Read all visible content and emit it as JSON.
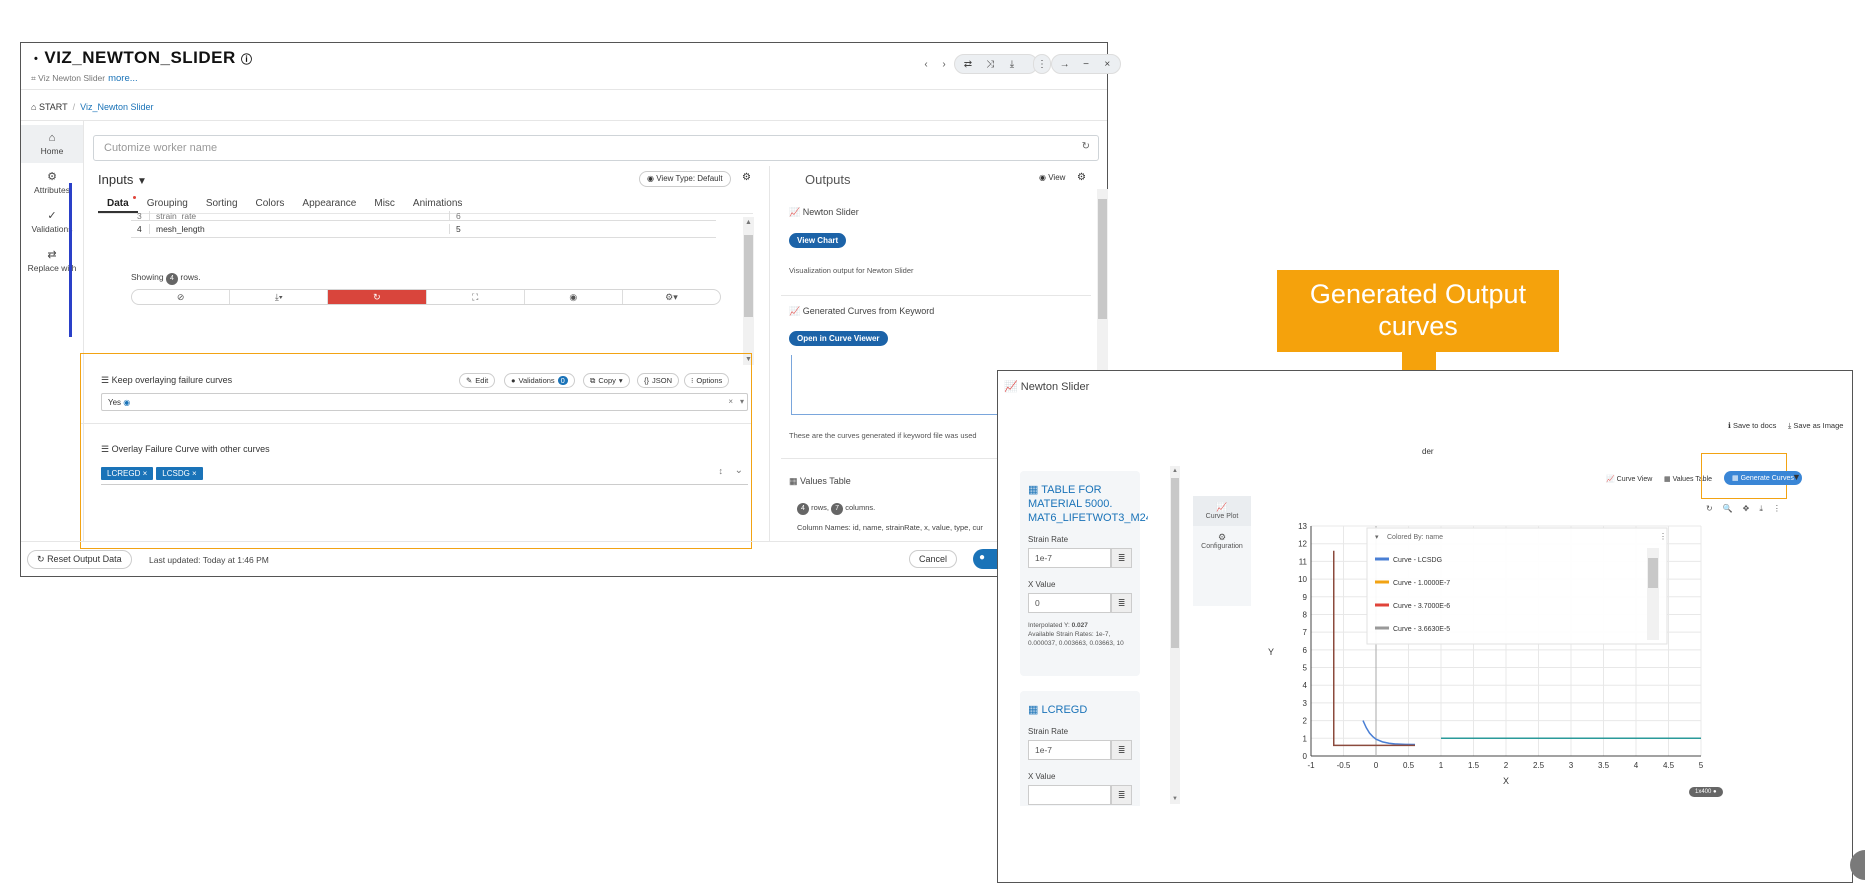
{
  "main_window": {
    "title": "VIZ_NEWTON_SLIDER",
    "subtitle": "Viz Newton Slider",
    "more_link": "more...",
    "breadcrumb": {
      "root": "START",
      "current": "Viz_Newton Slider"
    },
    "sidebar": [
      {
        "label": "Home",
        "icon": "home-icon"
      },
      {
        "label": "Attributes",
        "icon": "gear-icon"
      },
      {
        "label": "Validations",
        "icon": "check-icon"
      },
      {
        "label": "Replace with",
        "icon": "swap-icon"
      }
    ],
    "worker_name_placeholder": "Cutomize worker name",
    "inputs": {
      "header": "Inputs",
      "view_type": "View Type: Default",
      "tabs": [
        "Data",
        "Grouping",
        "Sorting",
        "Colors",
        "Appearance",
        "Misc",
        "Animations"
      ],
      "rows": [
        {
          "index": "3",
          "name": "strain_rate",
          "value": "6"
        },
        {
          "index": "4",
          "name": "mesh_length",
          "value": "5"
        }
      ],
      "showing_prefix": "Showing",
      "showing_count": "4",
      "showing_suffix": "rows."
    },
    "keep_overlaying": {
      "label": "Keep overlaying failure curves",
      "edit": "Edit",
      "validations": "Validations",
      "validations_count": "0",
      "copy": "Copy",
      "json": "JSON",
      "options": "Options",
      "value": "Yes"
    },
    "overlay": {
      "label": "Overlay Failure Curve with other curves",
      "chips": [
        "LCREGD",
        "LCSDG"
      ]
    },
    "footer": {
      "reset": "Reset Output Data",
      "updated": "Last updated: Today at 1:46 PM",
      "cancel": "Cancel"
    },
    "outputs": {
      "header": "Outputs",
      "view": "View",
      "newton": {
        "title": "Newton Slider",
        "button": "View Chart",
        "desc": "Visualization output for Newton Slider"
      },
      "curves": {
        "title": "Generated Curves from Keyword",
        "button": "Open in Curve Viewer",
        "desc": "These are the curves generated if keyword file was used"
      },
      "values": {
        "title": "Values Table",
        "rows": "4",
        "rows_label": "rows,",
        "cols": "7",
        "cols_label": "columns.",
        "columns_desc": "Column Names: id, name, strainRate, x, value, type, cur"
      }
    }
  },
  "callout": {
    "text": "Generated Output curves"
  },
  "newton_window": {
    "title": "Newton Slider",
    "save_docs": "Save to docs",
    "save_image": "Save as Image",
    "partial_title": "der",
    "curve_view": "Curve View",
    "values_table": "Values Table",
    "generate_curves": "Generate Curves",
    "side_tabs": [
      "Curve Plot",
      "Configuration"
    ],
    "table1": {
      "name": "TABLE FOR MATERIAL 5000. MAT6_LIFETWOT3_M24",
      "strain_rate_label": "Strain Rate",
      "strain_rate": "1e-7",
      "x_value_label": "X Value",
      "x_value": "0",
      "interp_label": "Interpolated Y:",
      "interp_value": "0.027",
      "available": "Available Strain Rates: 1e-7, 0.000037, 0.003663, 0.03663, 10"
    },
    "table2": {
      "name": "LCREGD",
      "strain_rate_label": "Strain Rate",
      "strain_rate": "1e-7",
      "x_value_label": "X Value"
    },
    "legend_header": "Colored By: name",
    "badge": "1x400",
    "colors": {
      "blue": "#4a7fd4",
      "orange": "#f2a313",
      "red": "#e0443a",
      "gray": "#999999",
      "brown": "#8b4a3c",
      "teal": "#2a9a9a"
    }
  },
  "chart_data": {
    "type": "line",
    "xlabel": "X",
    "ylabel": "Y",
    "xlim": [
      -1,
      5
    ],
    "ylim": [
      0,
      13
    ],
    "x_ticks": [
      "-1",
      "-0.5",
      "0",
      "0.5",
      "1",
      "1.5",
      "2",
      "2.5",
      "3",
      "3.5",
      "4",
      "4.5",
      "5"
    ],
    "y_ticks": [
      "0",
      "1",
      "2",
      "3",
      "4",
      "5",
      "6",
      "7",
      "8",
      "9",
      "10",
      "11",
      "12",
      "13"
    ],
    "legend": [
      "Curve - LCSDG",
      "Curve - 1.0000E-7",
      "Curve - 3.7000E-6",
      "Curve - 3.6630E-5"
    ],
    "legend_colors": [
      "#4a7fd4",
      "#f2a313",
      "#e0443a",
      "#999999"
    ],
    "series": [
      {
        "color": "#4a7fd4",
        "x": [
          -0.2,
          -0.15,
          -0.1,
          -0.05,
          0,
          0.1,
          0.2,
          0.3,
          0.45,
          0.6
        ],
        "y": [
          2.0,
          1.6,
          1.3,
          1.1,
          0.95,
          0.8,
          0.72,
          0.68,
          0.66,
          0.65
        ]
      },
      {
        "color": "#8b4a3c",
        "x": [
          -0.65,
          -0.65,
          0.6
        ],
        "y": [
          11.6,
          0.6,
          0.6
        ]
      },
      {
        "color": "#2a9a9a",
        "x": [
          1.0,
          5.0
        ],
        "y": [
          1.0,
          1.0
        ]
      }
    ]
  }
}
